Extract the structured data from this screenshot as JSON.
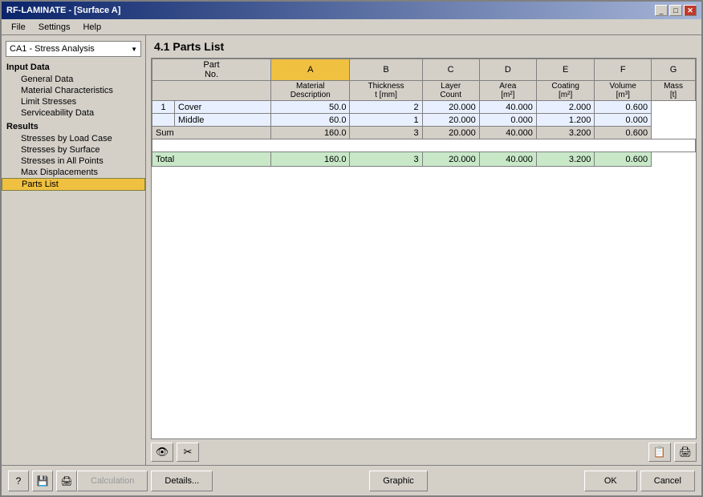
{
  "window": {
    "title": "RF-LAMINATE - [Surface A]",
    "close_btn": "✕",
    "min_btn": "_",
    "max_btn": "□"
  },
  "menu": {
    "items": [
      "File",
      "Settings",
      "Help"
    ]
  },
  "sidebar": {
    "dropdown": {
      "value": "CA1 - Stress Analysis",
      "options": [
        "CA1 - Stress Analysis"
      ]
    },
    "input_data_label": "Input Data",
    "input_items": [
      {
        "label": "General Data",
        "active": false
      },
      {
        "label": "Material Characteristics",
        "active": false
      },
      {
        "label": "Limit Stresses",
        "active": false
      },
      {
        "label": "Serviceability Data",
        "active": false
      }
    ],
    "results_label": "Results",
    "result_items": [
      {
        "label": "Stresses by Load Case",
        "active": false
      },
      {
        "label": "Stresses by Surface",
        "active": false
      },
      {
        "label": "Stresses in All Points",
        "active": false
      },
      {
        "label": "Max Displacements",
        "active": false
      },
      {
        "label": "Parts List",
        "active": true
      }
    ]
  },
  "main": {
    "title": "4.1 Parts List",
    "table": {
      "col_headers": [
        "A",
        "B",
        "C",
        "D",
        "E",
        "F",
        "G"
      ],
      "row_headers": {
        "part_no": "Part\nNo.",
        "col_a_sub": "Material\nDescription",
        "col_b_sub": "Thickness\nt [mm]",
        "col_c_sub": "Layer\nCount",
        "col_d_sub": "Area\n[m²]",
        "col_e_sub": "Coating\n[m²]",
        "col_f_sub": "Volume\n[m³]",
        "col_g_sub": "Mass\n[t]"
      },
      "rows": [
        {
          "part_no": "1",
          "material": "Cover",
          "thickness": "50.0",
          "layer_count": "2",
          "area": "20.000",
          "coating": "40.000",
          "volume": "2.000",
          "mass": "0.600"
        },
        {
          "part_no": "",
          "material": "Middle",
          "thickness": "60.0",
          "layer_count": "1",
          "area": "20.000",
          "coating": "0.000",
          "volume": "1.200",
          "mass": "0.000"
        }
      ],
      "sum_row": {
        "label": "Sum",
        "thickness": "160.0",
        "layer_count": "3",
        "area": "20.000",
        "coating": "40.000",
        "volume": "3.200",
        "mass": "0.600"
      },
      "total_row": {
        "label": "Total",
        "thickness": "160.0",
        "layer_count": "3",
        "area": "20.000",
        "coating": "40.000",
        "volume": "3.200",
        "mass": "0.600"
      }
    }
  },
  "toolbar": {
    "left_icons": [
      {
        "name": "eye-icon",
        "symbol": "👁"
      },
      {
        "name": "tool-icon",
        "symbol": "✂"
      }
    ],
    "right_icons": [
      {
        "name": "export-icon",
        "symbol": "📋"
      },
      {
        "name": "print-icon",
        "symbol": "🖨"
      }
    ]
  },
  "bottom_bar": {
    "left_buttons": [
      {
        "name": "help-button",
        "label": "?"
      },
      {
        "name": "save-button",
        "label": "💾"
      },
      {
        "name": "print-bottom-button",
        "label": "🖨"
      }
    ],
    "calculation_btn": "Calculation",
    "details_btn": "Details...",
    "graphic_btn": "Graphic",
    "ok_btn": "OK",
    "cancel_btn": "Cancel"
  },
  "colors": {
    "title_bar_start": "#0a246a",
    "title_bar_end": "#a6b5d7",
    "active_sidebar": "#f0c040",
    "table_data_bg": "#e8f0ff",
    "total_row_bg": "#c8e8c8",
    "col_a_header_bg": "#f0c040"
  }
}
